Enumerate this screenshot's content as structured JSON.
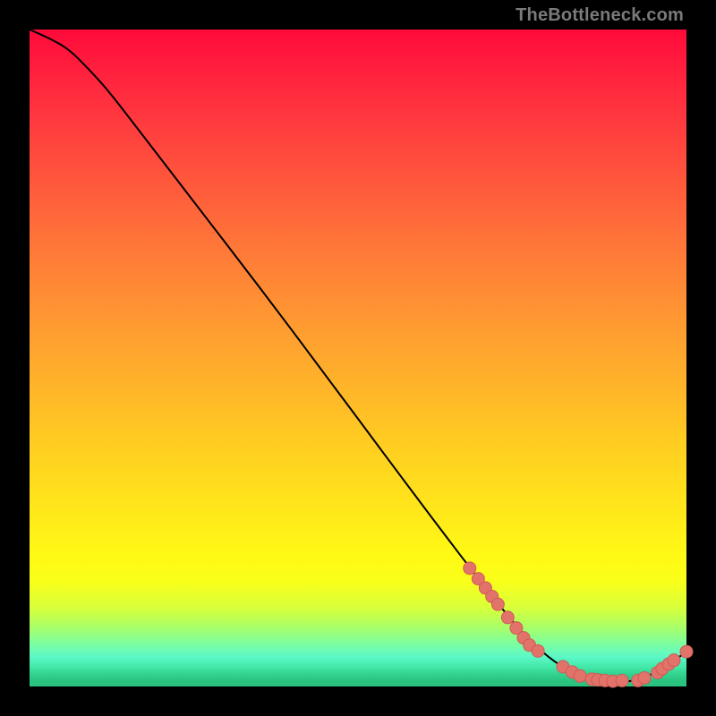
{
  "watermark": "TheBottleneck.com",
  "colors": {
    "curve_stroke": "#000000",
    "dot_fill": "#e2736b",
    "dot_stroke": "#d05a54"
  },
  "chart_data": {
    "type": "line",
    "title": "",
    "xlabel": "",
    "ylabel": "",
    "xlim": [
      0,
      100
    ],
    "ylim": [
      0,
      100
    ],
    "curve": [
      {
        "x": 0,
        "y": 100
      },
      {
        "x": 3,
        "y": 98.7
      },
      {
        "x": 6,
        "y": 97.0
      },
      {
        "x": 9,
        "y": 94.0
      },
      {
        "x": 12,
        "y": 90.7
      },
      {
        "x": 17,
        "y": 84.2
      },
      {
        "x": 25,
        "y": 73.8
      },
      {
        "x": 35,
        "y": 60.8
      },
      {
        "x": 45,
        "y": 47.5
      },
      {
        "x": 55,
        "y": 34.0
      },
      {
        "x": 65,
        "y": 20.7
      },
      {
        "x": 72,
        "y": 11.7
      },
      {
        "x": 76,
        "y": 7.1
      },
      {
        "x": 80,
        "y": 3.6
      },
      {
        "x": 84,
        "y": 1.4
      },
      {
        "x": 88,
        "y": 0.7
      },
      {
        "x": 92,
        "y": 0.7
      },
      {
        "x": 96,
        "y": 2.4
      },
      {
        "x": 100,
        "y": 5.3
      }
    ],
    "series": [
      {
        "name": "dotted-segment-descent",
        "type": "scatter",
        "points": [
          {
            "x": 67.0,
            "y": 18.0
          },
          {
            "x": 68.3,
            "y": 16.4
          },
          {
            "x": 69.4,
            "y": 15.0
          },
          {
            "x": 70.4,
            "y": 13.7
          },
          {
            "x": 71.3,
            "y": 12.5
          },
          {
            "x": 72.8,
            "y": 10.5
          },
          {
            "x": 74.1,
            "y": 8.9
          },
          {
            "x": 75.2,
            "y": 7.4
          },
          {
            "x": 76.1,
            "y": 6.3
          },
          {
            "x": 77.4,
            "y": 5.4
          }
        ]
      },
      {
        "name": "dotted-segment-valley",
        "type": "scatter",
        "points": [
          {
            "x": 81.2,
            "y": 3.0
          },
          {
            "x": 82.6,
            "y": 2.2
          },
          {
            "x": 83.8,
            "y": 1.6
          },
          {
            "x": 85.6,
            "y": 1.1
          },
          {
            "x": 86.5,
            "y": 1.0
          },
          {
            "x": 87.6,
            "y": 0.9
          },
          {
            "x": 88.8,
            "y": 0.8
          },
          {
            "x": 90.2,
            "y": 0.9
          },
          {
            "x": 92.6,
            "y": 0.9
          },
          {
            "x": 93.6,
            "y": 1.3
          },
          {
            "x": 95.6,
            "y": 2.1
          },
          {
            "x": 96.3,
            "y": 2.7
          },
          {
            "x": 97.3,
            "y": 3.4
          },
          {
            "x": 98.1,
            "y": 4.0
          }
        ]
      },
      {
        "name": "dotted-segment-end",
        "type": "scatter",
        "points": [
          {
            "x": 100.0,
            "y": 5.3
          }
        ]
      }
    ]
  }
}
